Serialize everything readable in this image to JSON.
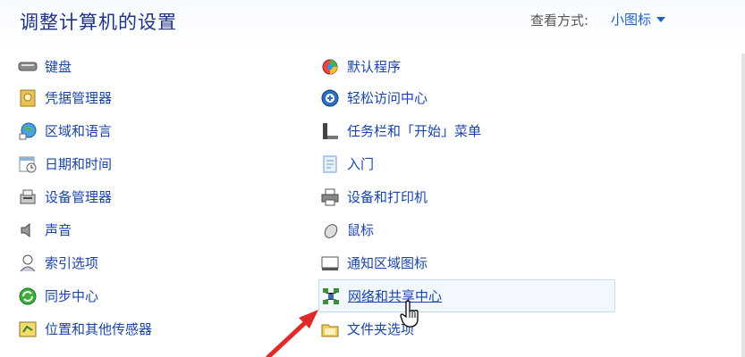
{
  "header": {
    "title": "调整计算机的设置",
    "view_label": "查看方式:",
    "view_value": "小图标"
  },
  "left_items": [
    {
      "label": "键盘",
      "icon": "keyboard-icon"
    },
    {
      "label": "凭据管理器",
      "icon": "credential-manager-icon"
    },
    {
      "label": "区域和语言",
      "icon": "region-language-icon"
    },
    {
      "label": "日期和时间",
      "icon": "date-time-icon"
    },
    {
      "label": "设备管理器",
      "icon": "device-manager-icon"
    },
    {
      "label": "声音",
      "icon": "sound-icon"
    },
    {
      "label": "索引选项",
      "icon": "indexing-options-icon"
    },
    {
      "label": "同步中心",
      "icon": "sync-center-icon"
    },
    {
      "label": "位置和其他传感器",
      "icon": "location-sensors-icon"
    }
  ],
  "right_items": [
    {
      "label": "默认程序",
      "icon": "default-programs-icon"
    },
    {
      "label": "轻松访问中心",
      "icon": "ease-of-access-icon"
    },
    {
      "label": "任务栏和「开始」菜单",
      "icon": "taskbar-start-menu-icon"
    },
    {
      "label": "入门",
      "icon": "getting-started-icon"
    },
    {
      "label": "设备和打印机",
      "icon": "devices-printers-icon"
    },
    {
      "label": "鼠标",
      "icon": "mouse-icon"
    },
    {
      "label": "通知区域图标",
      "icon": "notification-area-icon"
    },
    {
      "label": "网络和共享中心",
      "icon": "network-sharing-icon"
    },
    {
      "label": "文件夹选项",
      "icon": "folder-options-icon"
    }
  ],
  "colors": {
    "title": "#1e3287",
    "link": "#1a45a8",
    "arrow": "#e02a2a",
    "hover_border": "#c4dcf5"
  }
}
